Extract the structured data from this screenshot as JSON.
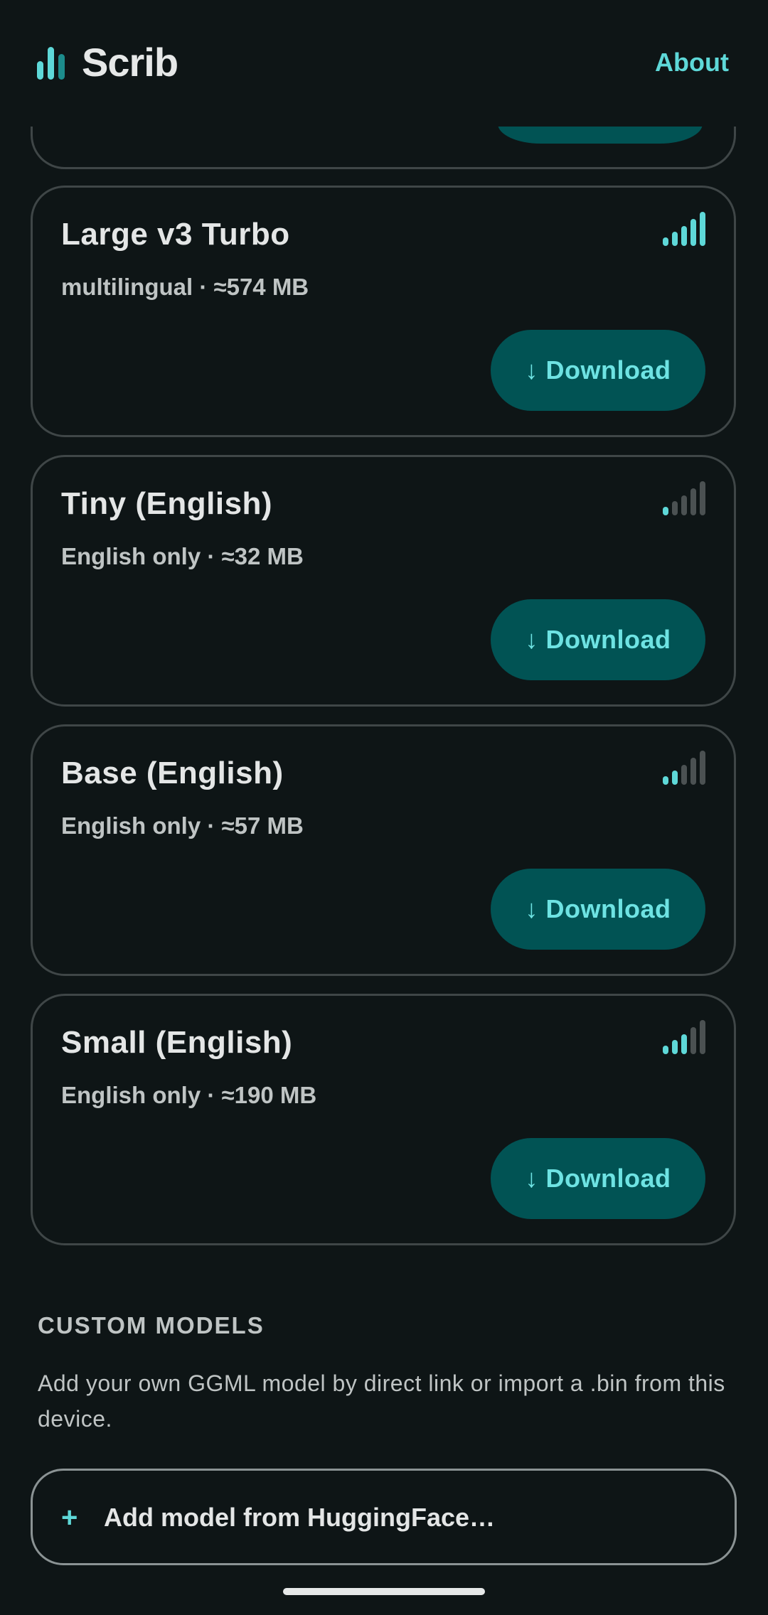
{
  "header": {
    "title": "Scrib",
    "about_label": "About"
  },
  "colors": {
    "accent": "#5ed8d8",
    "button_bg": "#015354",
    "bar_inactive": "#4b5152",
    "background": "#0e1516"
  },
  "models": [
    {
      "name": "Large v3 Turbo",
      "detail": "multilingual · ≈574 MB",
      "button_label": "↓ Download",
      "signal_level": 5,
      "signal_max": 5
    },
    {
      "name": "Tiny (English)",
      "detail": "English only · ≈32 MB",
      "button_label": "↓ Download",
      "signal_level": 1,
      "signal_max": 5
    },
    {
      "name": "Base (English)",
      "detail": "English only · ≈57 MB",
      "button_label": "↓ Download",
      "signal_level": 2,
      "signal_max": 5
    },
    {
      "name": "Small (English)",
      "detail": "English only · ≈190 MB",
      "button_label": "↓ Download",
      "signal_level": 3,
      "signal_max": 5
    }
  ],
  "custom_models": {
    "header": "CUSTOM MODELS",
    "description": "Add your own GGML model by direct link or import a .bin from this device.",
    "add_icon": "+",
    "add_label": "Add model from HuggingFace…"
  }
}
